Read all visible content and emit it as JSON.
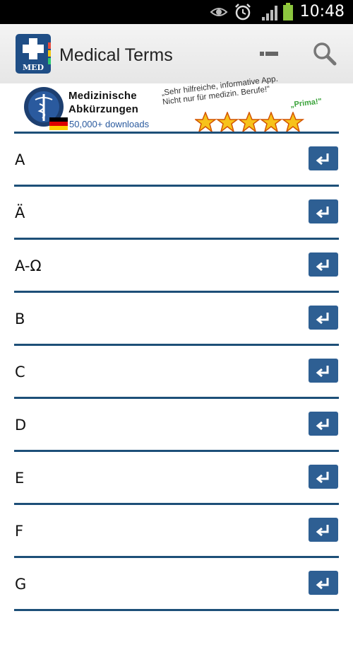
{
  "status_bar": {
    "time": "10:48"
  },
  "action_bar": {
    "title": "Medical Terms",
    "icon_label": "MED"
  },
  "banner": {
    "title_line1": "Medizinische",
    "title_line2": "Abkürzungen",
    "downloads": "50,000+ downloads",
    "quote": "„Sehr hilfreiche, informative App. Nicht nur für medizin. Berufe!\"",
    "prima": "„Prima!\"",
    "rating_stars": 5
  },
  "list": {
    "items": [
      {
        "label": "A"
      },
      {
        "label": "Ä"
      },
      {
        "label": "A-Ω"
      },
      {
        "label": "B"
      },
      {
        "label": "C"
      },
      {
        "label": "D"
      },
      {
        "label": "E"
      },
      {
        "label": "F"
      },
      {
        "label": "G"
      }
    ]
  },
  "colors": {
    "accent": "#1d4f78",
    "button": "#2e5f93"
  }
}
